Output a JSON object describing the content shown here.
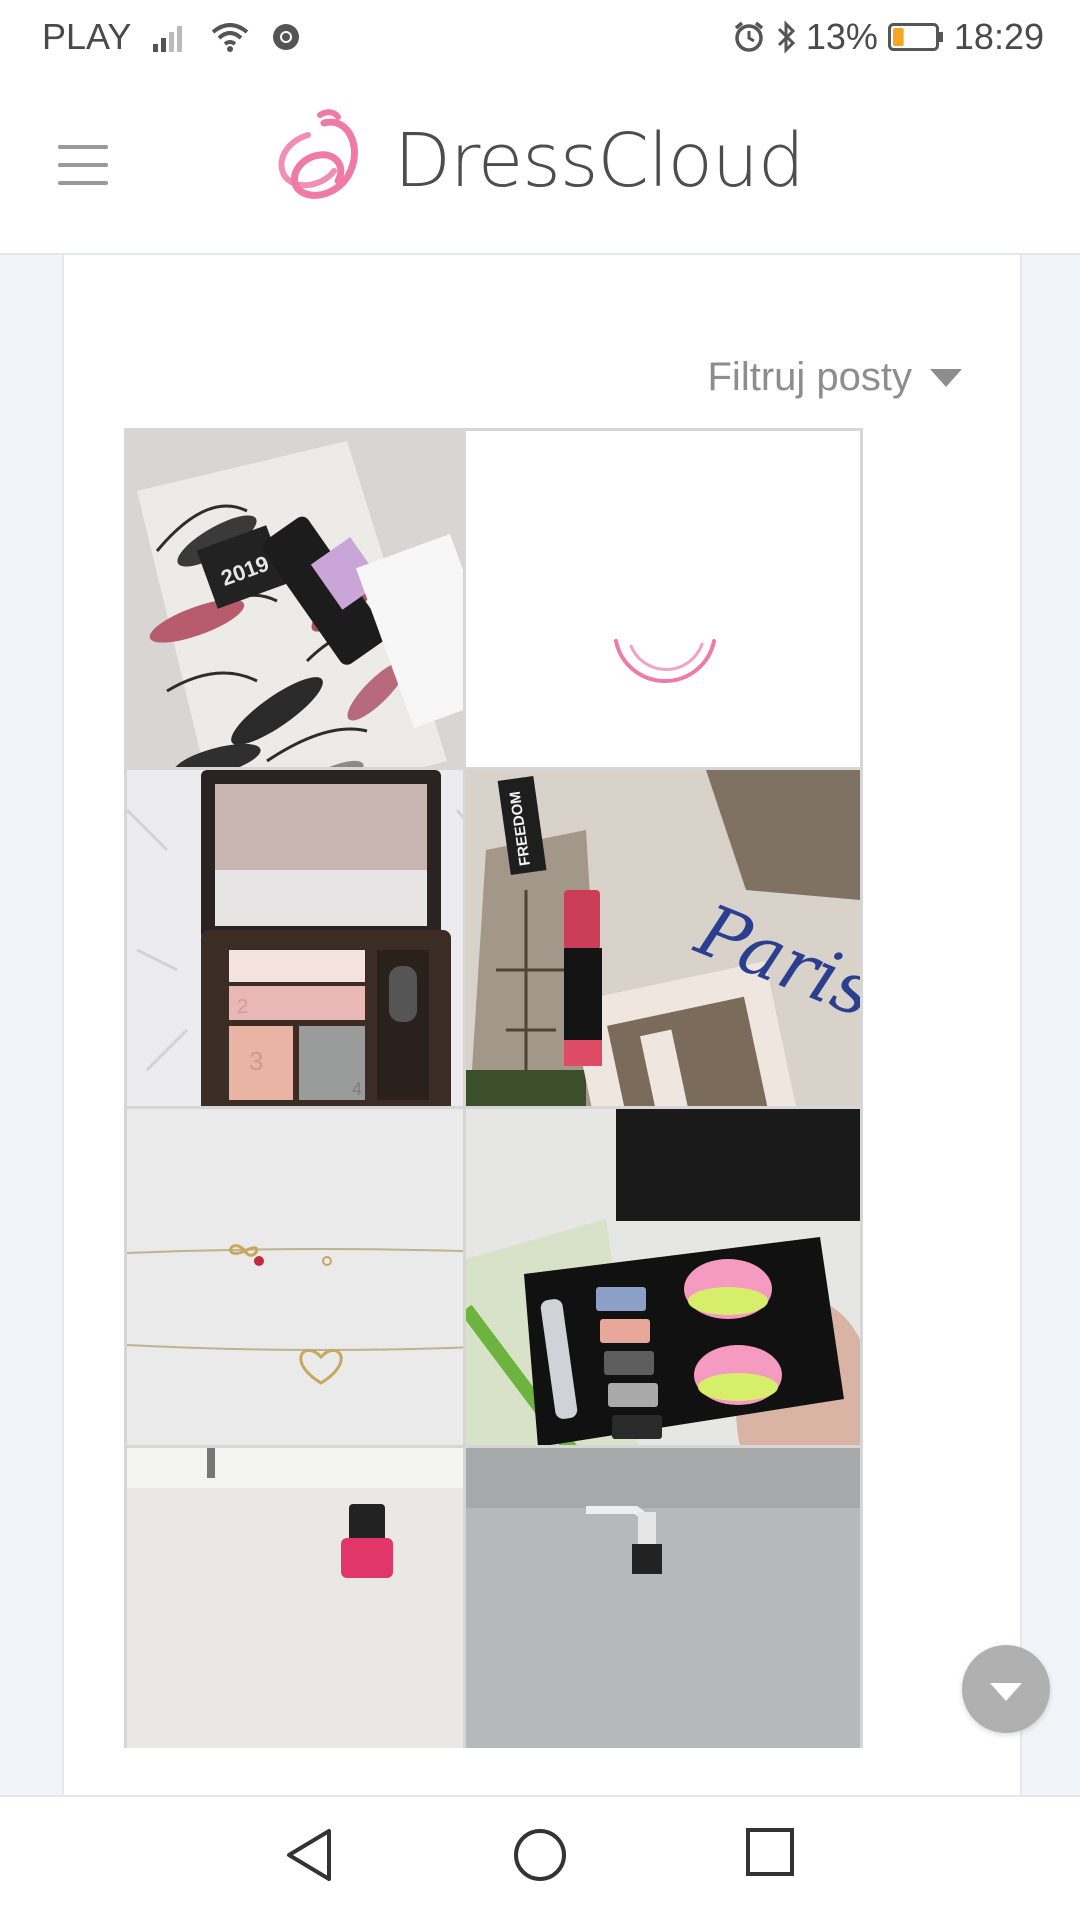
{
  "status_bar": {
    "carrier": "PLAY",
    "battery_percent": "13%",
    "time": "18:29",
    "battery_level": 0.13,
    "icons": [
      "signal-icon",
      "wifi-icon",
      "chrome-icon",
      "alarm-icon",
      "bluetooth-icon",
      "battery-icon"
    ]
  },
  "header": {
    "menu_icon": "hamburger-icon",
    "logo_text": "DressCloud",
    "brand_color": "#ee7aa5"
  },
  "content": {
    "filter_label": "Filtruj posty",
    "filter_icon": "caret-down-icon",
    "posts": [
      {
        "kind": "photo",
        "subject": "feather-calendar-spray",
        "calendar_text": "2019"
      },
      {
        "kind": "loading",
        "icon": "loading-spinner-icon"
      },
      {
        "kind": "photo",
        "subject": "eyeshadow-palette",
        "palette_numbers": [
          "2",
          "3",
          "4"
        ]
      },
      {
        "kind": "photo",
        "subject": "lipstick-paris",
        "box_text": "FREEDOM",
        "script_text": "Paris"
      },
      {
        "kind": "photo",
        "subject": "necklaces"
      },
      {
        "kind": "photo",
        "subject": "nail-polish-kit"
      },
      {
        "kind": "photo",
        "subject": "pink-bottle"
      },
      {
        "kind": "photo",
        "subject": "pump-bottle"
      }
    ]
  },
  "fab": {
    "icon": "scroll-down-icon"
  },
  "nav_bar": {
    "back_icon": "back-triangle-icon",
    "home_icon": "home-circle-icon",
    "recents_icon": "recents-square-icon"
  }
}
